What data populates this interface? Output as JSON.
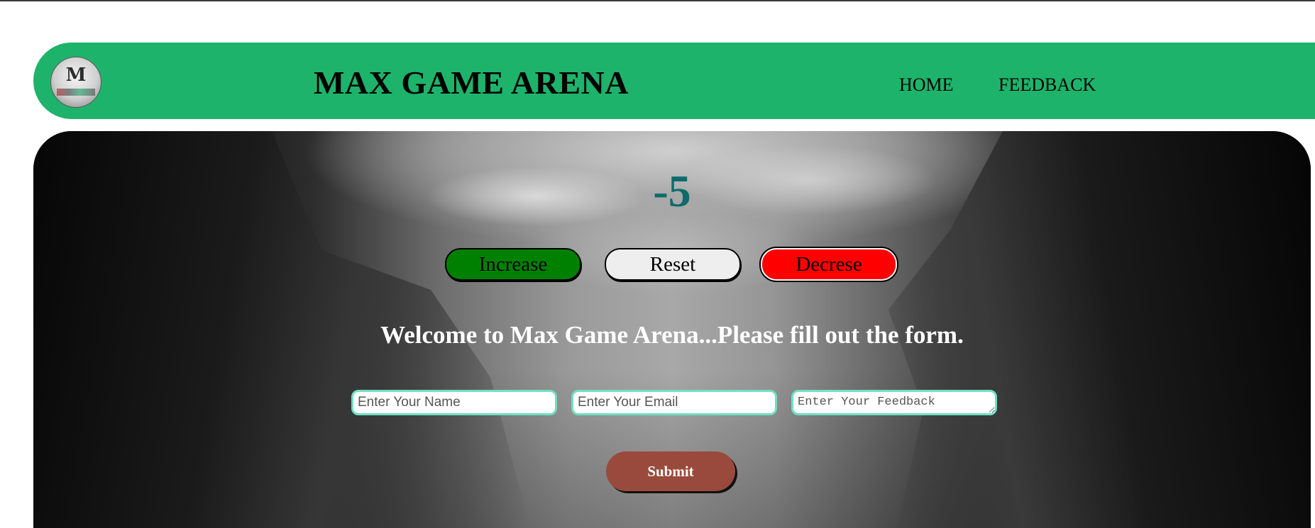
{
  "header": {
    "logo_text": "M",
    "logo_icon": "max-game-arena-logo",
    "title": "MAX GAME ARENA",
    "nav": [
      {
        "label": "HOME"
      },
      {
        "label": "FEEDBACK"
      }
    ],
    "colors": {
      "nav_bg": "#1db36b"
    }
  },
  "counter": {
    "value": "-5",
    "color": "#0f6b6b"
  },
  "controls": {
    "increase_label": "Increase",
    "reset_label": "Reset",
    "decrease_label": "Decrese",
    "colors": {
      "increase": "#008000",
      "reset": "#eeeeee",
      "decrease": "#ff0000"
    }
  },
  "form": {
    "heading": "Welcome to Max Game Arena...Please fill out the form.",
    "name_placeholder": "Enter Your Name",
    "email_placeholder": "Enter Your Email",
    "feedback_placeholder": "Enter Your Feedback",
    "name_value": "",
    "email_value": "",
    "feedback_value": "",
    "submit_label": "Submit",
    "colors": {
      "field_border": "#6fe0c2",
      "submit_bg": "#9a4a3c"
    }
  }
}
